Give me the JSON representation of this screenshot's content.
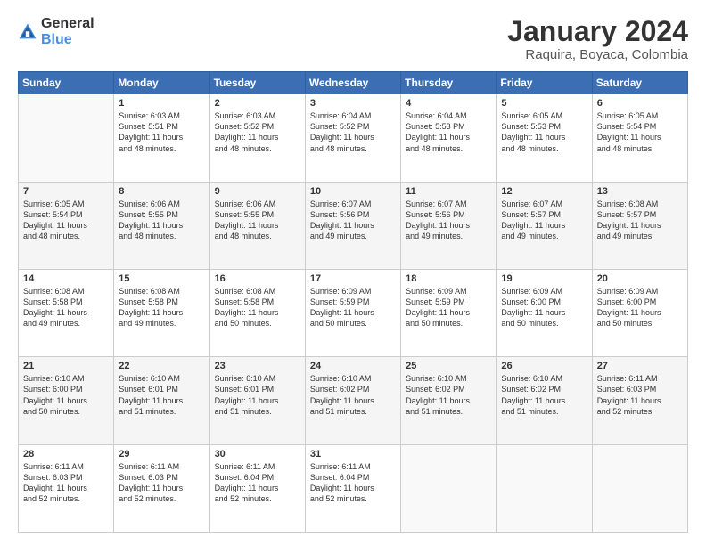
{
  "header": {
    "logo_general": "General",
    "logo_blue": "Blue",
    "title": "January 2024",
    "subtitle": "Raquira, Boyaca, Colombia"
  },
  "days_of_week": [
    "Sunday",
    "Monday",
    "Tuesday",
    "Wednesday",
    "Thursday",
    "Friday",
    "Saturday"
  ],
  "weeks": [
    [
      {
        "day": "",
        "info": ""
      },
      {
        "day": "1",
        "info": "Sunrise: 6:03 AM\nSunset: 5:51 PM\nDaylight: 11 hours\nand 48 minutes."
      },
      {
        "day": "2",
        "info": "Sunrise: 6:03 AM\nSunset: 5:52 PM\nDaylight: 11 hours\nand 48 minutes."
      },
      {
        "day": "3",
        "info": "Sunrise: 6:04 AM\nSunset: 5:52 PM\nDaylight: 11 hours\nand 48 minutes."
      },
      {
        "day": "4",
        "info": "Sunrise: 6:04 AM\nSunset: 5:53 PM\nDaylight: 11 hours\nand 48 minutes."
      },
      {
        "day": "5",
        "info": "Sunrise: 6:05 AM\nSunset: 5:53 PM\nDaylight: 11 hours\nand 48 minutes."
      },
      {
        "day": "6",
        "info": "Sunrise: 6:05 AM\nSunset: 5:54 PM\nDaylight: 11 hours\nand 48 minutes."
      }
    ],
    [
      {
        "day": "7",
        "info": "Sunrise: 6:05 AM\nSunset: 5:54 PM\nDaylight: 11 hours\nand 48 minutes."
      },
      {
        "day": "8",
        "info": "Sunrise: 6:06 AM\nSunset: 5:55 PM\nDaylight: 11 hours\nand 48 minutes."
      },
      {
        "day": "9",
        "info": "Sunrise: 6:06 AM\nSunset: 5:55 PM\nDaylight: 11 hours\nand 48 minutes."
      },
      {
        "day": "10",
        "info": "Sunrise: 6:07 AM\nSunset: 5:56 PM\nDaylight: 11 hours\nand 49 minutes."
      },
      {
        "day": "11",
        "info": "Sunrise: 6:07 AM\nSunset: 5:56 PM\nDaylight: 11 hours\nand 49 minutes."
      },
      {
        "day": "12",
        "info": "Sunrise: 6:07 AM\nSunset: 5:57 PM\nDaylight: 11 hours\nand 49 minutes."
      },
      {
        "day": "13",
        "info": "Sunrise: 6:08 AM\nSunset: 5:57 PM\nDaylight: 11 hours\nand 49 minutes."
      }
    ],
    [
      {
        "day": "14",
        "info": "Sunrise: 6:08 AM\nSunset: 5:58 PM\nDaylight: 11 hours\nand 49 minutes."
      },
      {
        "day": "15",
        "info": "Sunrise: 6:08 AM\nSunset: 5:58 PM\nDaylight: 11 hours\nand 49 minutes."
      },
      {
        "day": "16",
        "info": "Sunrise: 6:08 AM\nSunset: 5:58 PM\nDaylight: 11 hours\nand 50 minutes."
      },
      {
        "day": "17",
        "info": "Sunrise: 6:09 AM\nSunset: 5:59 PM\nDaylight: 11 hours\nand 50 minutes."
      },
      {
        "day": "18",
        "info": "Sunrise: 6:09 AM\nSunset: 5:59 PM\nDaylight: 11 hours\nand 50 minutes."
      },
      {
        "day": "19",
        "info": "Sunrise: 6:09 AM\nSunset: 6:00 PM\nDaylight: 11 hours\nand 50 minutes."
      },
      {
        "day": "20",
        "info": "Sunrise: 6:09 AM\nSunset: 6:00 PM\nDaylight: 11 hours\nand 50 minutes."
      }
    ],
    [
      {
        "day": "21",
        "info": "Sunrise: 6:10 AM\nSunset: 6:00 PM\nDaylight: 11 hours\nand 50 minutes."
      },
      {
        "day": "22",
        "info": "Sunrise: 6:10 AM\nSunset: 6:01 PM\nDaylight: 11 hours\nand 51 minutes."
      },
      {
        "day": "23",
        "info": "Sunrise: 6:10 AM\nSunset: 6:01 PM\nDaylight: 11 hours\nand 51 minutes."
      },
      {
        "day": "24",
        "info": "Sunrise: 6:10 AM\nSunset: 6:02 PM\nDaylight: 11 hours\nand 51 minutes."
      },
      {
        "day": "25",
        "info": "Sunrise: 6:10 AM\nSunset: 6:02 PM\nDaylight: 11 hours\nand 51 minutes."
      },
      {
        "day": "26",
        "info": "Sunrise: 6:10 AM\nSunset: 6:02 PM\nDaylight: 11 hours\nand 51 minutes."
      },
      {
        "day": "27",
        "info": "Sunrise: 6:11 AM\nSunset: 6:03 PM\nDaylight: 11 hours\nand 52 minutes."
      }
    ],
    [
      {
        "day": "28",
        "info": "Sunrise: 6:11 AM\nSunset: 6:03 PM\nDaylight: 11 hours\nand 52 minutes."
      },
      {
        "day": "29",
        "info": "Sunrise: 6:11 AM\nSunset: 6:03 PM\nDaylight: 11 hours\nand 52 minutes."
      },
      {
        "day": "30",
        "info": "Sunrise: 6:11 AM\nSunset: 6:04 PM\nDaylight: 11 hours\nand 52 minutes."
      },
      {
        "day": "31",
        "info": "Sunrise: 6:11 AM\nSunset: 6:04 PM\nDaylight: 11 hours\nand 52 minutes."
      },
      {
        "day": "",
        "info": ""
      },
      {
        "day": "",
        "info": ""
      },
      {
        "day": "",
        "info": ""
      }
    ]
  ]
}
